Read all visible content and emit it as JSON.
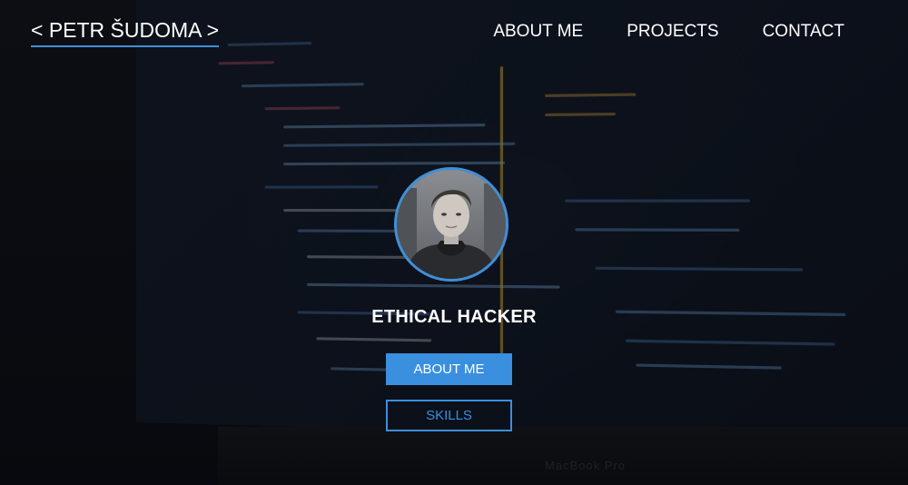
{
  "header": {
    "logo_text": "< PETR ŠUDOMA >",
    "nav": [
      {
        "label": "ABOUT ME"
      },
      {
        "label": "PROJECTS"
      },
      {
        "label": "CONTACT"
      }
    ]
  },
  "hero": {
    "title": "ETHICAL HACKER",
    "primary_button": "ABOUT ME",
    "secondary_button": "SKILLS"
  },
  "colors": {
    "accent": "#3a8fde",
    "text": "#ffffff",
    "background": "#0b0d12"
  }
}
